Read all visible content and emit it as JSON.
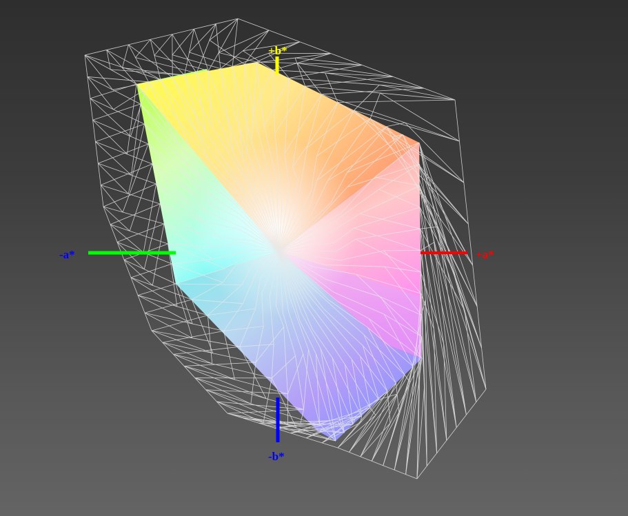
{
  "axes": {
    "pos_a": {
      "label": "+a*",
      "color": "#ff0000"
    },
    "neg_a": {
      "label": "-a*",
      "color": "#0000ff"
    },
    "pos_b": {
      "label": "+b*",
      "color": "#ffff00"
    },
    "neg_b": {
      "label": "-b*",
      "color": "#0000ff"
    },
    "a_axis_color_neg": "#00ff00",
    "a_axis_color_pos": "#ff0000",
    "b_axis_color_pos": "#ffff00",
    "b_axis_color_neg": "#0000ff"
  },
  "solid_colors": {
    "green": "#b8ff3c",
    "yellow": "#ffff48",
    "orange": "#ff9c5c",
    "red": "#ff7878",
    "magenta": "#ff8cf8",
    "blue": "#7890ff",
    "cyan": "#7cf8f8",
    "white": "#fffff0"
  },
  "wireframe_color": "#e8e8e8"
}
